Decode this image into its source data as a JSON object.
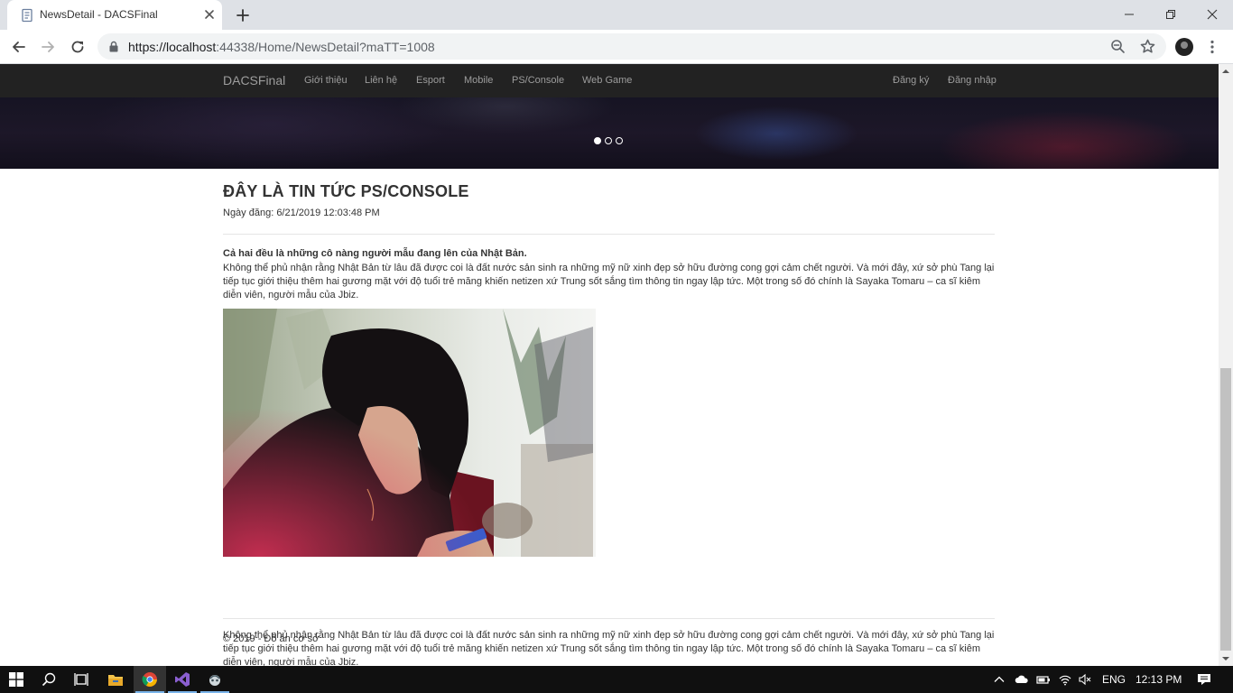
{
  "browser": {
    "tab_title": "NewsDetail - DACSFinal",
    "url_host": "https://localhost",
    "url_rest": ":44338/Home/NewsDetail?maTT=1008"
  },
  "navbar": {
    "brand": "DACSFinal",
    "links": [
      "Giới thiệu",
      "Liên hệ",
      "Esport",
      "Mobile",
      "PS/Console",
      "Web Game"
    ],
    "register": "Đăng ký",
    "login": "Đăng nhập"
  },
  "carousel": {
    "slides": 3,
    "active_slide": 1
  },
  "article": {
    "title": "ĐÂY LÀ TIN TỨC PS/CONSOLE",
    "date_label": "Ngày đăng: 6/21/2019 12:03:48 PM",
    "lead": "Cả hai đều là những cô nàng người mẫu đang lên của Nhật Bản.",
    "paragraph1": "Không thể phủ nhận rằng Nhật Bản từ lâu đã được coi là đất nước sản sinh ra những mỹ nữ xinh đẹp sở hữu đường cong gợi cảm chết người. Và mới đây, xứ sở phù Tang lại tiếp tục giới thiệu thêm hai gương mặt với độ tuổi trẻ măng khiến netizen xứ Trung sốt sắng tìm thông tin ngay lập tức. Một trong số đó chính là Sayaka Tomaru – ca sĩ kiêm diễn viên, người mẫu của Jbiz.",
    "paragraph2": "Không thể phủ nhận rằng Nhật Bản từ lâu đã được coi là đất nước sản sinh ra những mỹ nữ xinh đẹp sở hữu đường cong gợi cảm chết người. Và mới đây, xứ sở phù Tang lại tiếp tục giới thiệu thêm hai gương mặt với độ tuổi trẻ măng khiến netizen xứ Trung sốt sắng tìm thông tin ngay lập tức. Một trong số đó chính là Sayaka Tomaru – ca sĩ kiêm diễn viên, người mẫu của Jbiz."
  },
  "footer": {
    "text": "© 2019 - Đồ án cơ sở"
  },
  "taskbar": {
    "language": "ENG",
    "time": "12:13 PM"
  },
  "colors": {
    "navbar_bg": "#222222",
    "nav_link": "#9d9d9d",
    "text": "#333333",
    "taskbar_bg": "#101010"
  }
}
